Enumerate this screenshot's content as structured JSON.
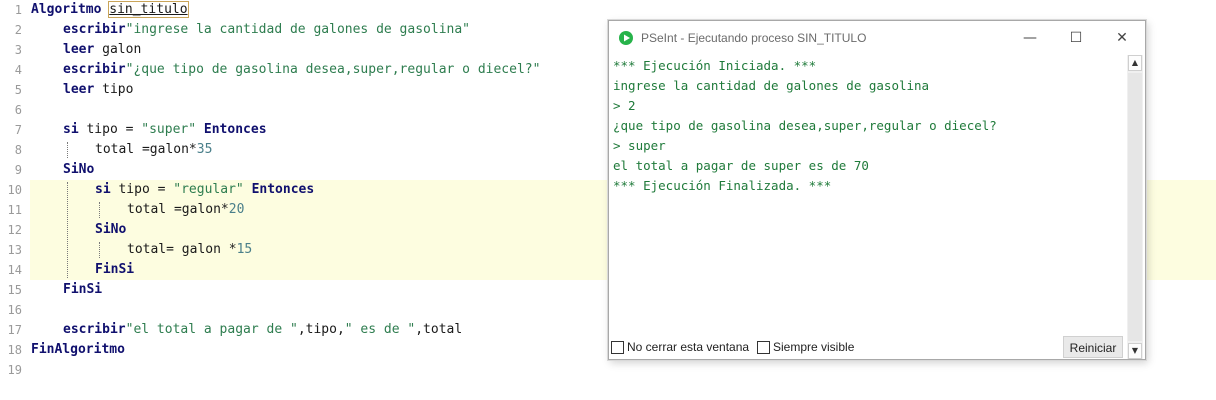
{
  "editor": {
    "line_numbers": [
      "1",
      "2",
      "3",
      "4",
      "5",
      "6",
      "7",
      "8",
      "9",
      "10",
      "11",
      "12",
      "13",
      "14",
      "15",
      "16",
      "17",
      "18",
      "19"
    ],
    "l1": {
      "kw": "Algoritmo",
      "name": "sin_titulo"
    },
    "l2": {
      "kw": "escribir",
      "str": "\"ingrese la cantidad de galones de gasolina\""
    },
    "l3": {
      "kw": "leer",
      "rest": "galon"
    },
    "l4": {
      "kw": "escribir",
      "str": "\"¿que tipo de gasolina desea,super,regular o diecel?\""
    },
    "l5": {
      "kw": "leer",
      "rest": "tipo"
    },
    "l7": {
      "kw": "si",
      "pre": "tipo = ",
      "str": "\"super\"",
      "kw2": "Entonces"
    },
    "l8": {
      "pre": "total =galon",
      "op": "*",
      "num": "35"
    },
    "l9": {
      "kw": "SiNo"
    },
    "l10": {
      "kw": "si",
      "pre": "tipo = ",
      "str": "\"regular\"",
      "kw2": "Entonces"
    },
    "l11": {
      "pre": "total =galon",
      "op": "*",
      "num": "20"
    },
    "l12": {
      "kw": "SiNo"
    },
    "l13": {
      "pre": "total= galon ",
      "op": "*",
      "num": "15"
    },
    "l14": {
      "kw": "FinSi"
    },
    "l15": {
      "kw": "FinSi"
    },
    "l17": {
      "kw": "escribir",
      "str": "\"el total a pagar de \"",
      "rest": ",tipo,",
      "str2": "\" es de \"",
      "rest2": ",total"
    },
    "l18": {
      "kw": "FinAlgoritmo"
    }
  },
  "console": {
    "title": "PSeInt - Ejecutando proceso SIN_TITULO",
    "minimize": "—",
    "maximize": "☐",
    "close": "✕",
    "output": [
      "*** Ejecución Iniciada. ***",
      "ingrese la cantidad de galones de gasolina",
      "> 2",
      "¿que tipo de gasolina desea,super,regular o diecel?",
      "> super",
      "el total a pagar de super es de 70",
      "*** Ejecución Finalizada. ***"
    ],
    "keep_open_label": "No cerrar esta ventana",
    "always_visible_label": "Siempre visible",
    "restart_label": "Reiniciar",
    "scroll_up": "▲",
    "scroll_down": "▼",
    "icon": "play-icon",
    "accent": "#27b34a"
  }
}
